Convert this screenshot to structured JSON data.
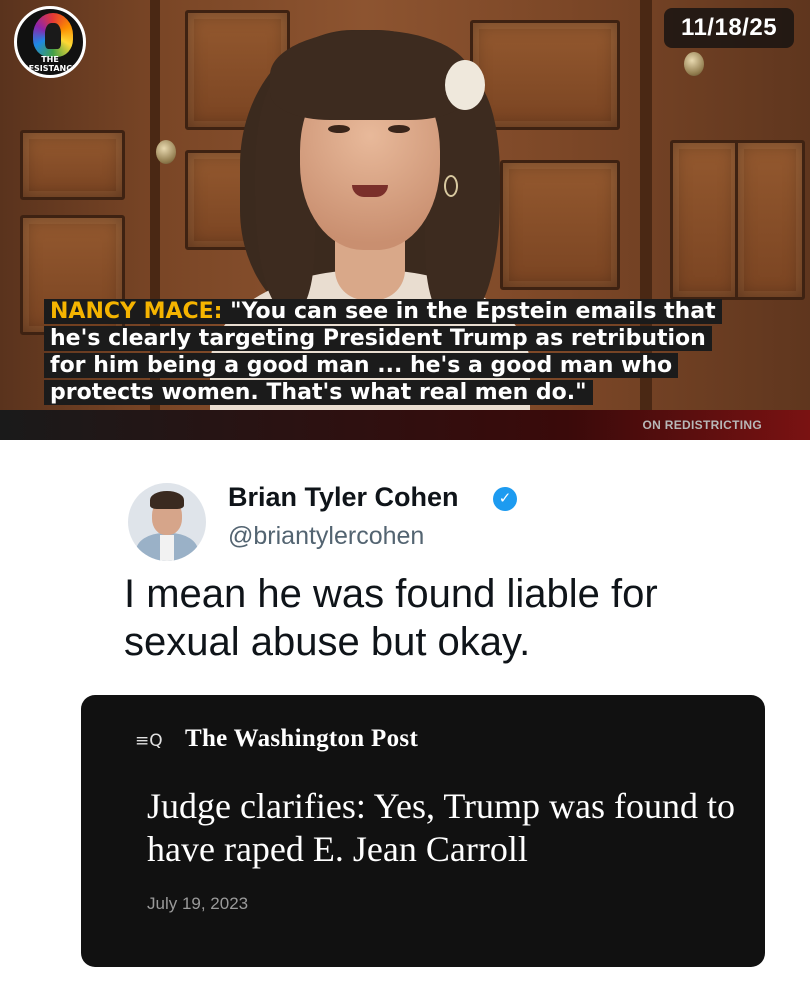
{
  "video": {
    "date": "11/18/25",
    "logo_text": [
      "THE",
      "RESISTANCE"
    ],
    "caption_speaker": "NANCY MACE:",
    "caption_lines": [
      "\"You can see in the Epstein emails that",
      "he's clearly targeting President Trump as retribution",
      "for him being a good man ... he's a good man who",
      "protects women. That's what real men do.\""
    ],
    "ticker_text": "ON REDISTRICTING"
  },
  "tweet": {
    "author_name": "Brian Tyler Cohen",
    "verified_icon": "verified-check-icon",
    "handle": "@briantylercohen",
    "text": "I mean he was found liable for sexual abuse but okay.",
    "card": {
      "icon_glyph": "≡Q",
      "publication": "The Washington Post",
      "headline": "Judge clarifies: Yes, Trump was found to have raped E. Jean Carroll",
      "date": "July 19, 2023"
    }
  },
  "colors": {
    "caption_speaker": "#f5b400",
    "caption_bg": "#1b1b1b",
    "verified_blue": "#1d9bf0",
    "card_bg": "#111111"
  }
}
